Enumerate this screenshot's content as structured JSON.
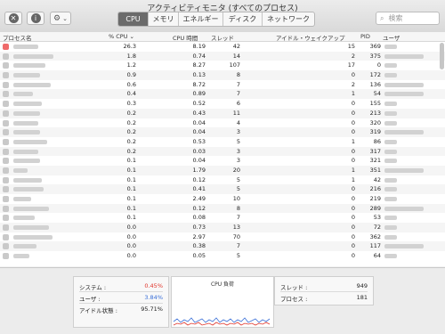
{
  "window": {
    "title": "アクティビティモニタ (すべてのプロセス)"
  },
  "toolbar": {
    "tabs": [
      "CPU",
      "メモリ",
      "エネルギー",
      "ディスク",
      "ネットワーク"
    ],
    "active_tab": "CPU",
    "search_placeholder": "検索",
    "icons": [
      "close-process-icon",
      "info-icon",
      "gear-icon"
    ],
    "gear_chevron": "⌄"
  },
  "table": {
    "headers": [
      "プロセス名",
      "% CPU",
      "CPU 時間",
      "スレッド",
      "アイドル・ウェイクアップ",
      "PID",
      "ユーザ"
    ],
    "rows": [
      {
        "cpu": "26.3",
        "time": "8.19",
        "threads": "42",
        "wake": "15",
        "pid": "369"
      },
      {
        "cpu": "1.8",
        "time": "0.74",
        "threads": "14",
        "wake": "2",
        "pid": "375"
      },
      {
        "cpu": "1.2",
        "time": "8.27",
        "threads": "107",
        "wake": "17",
        "pid": "0"
      },
      {
        "cpu": "0.9",
        "time": "0.13",
        "threads": "8",
        "wake": "0",
        "pid": "172"
      },
      {
        "cpu": "0.6",
        "time": "8.72",
        "threads": "7",
        "wake": "2",
        "pid": "136"
      },
      {
        "cpu": "0.4",
        "time": "0.89",
        "threads": "7",
        "wake": "1",
        "pid": "54"
      },
      {
        "cpu": "0.3",
        "time": "0.52",
        "threads": "6",
        "wake": "0",
        "pid": "155"
      },
      {
        "cpu": "0.2",
        "time": "0.43",
        "threads": "11",
        "wake": "0",
        "pid": "213"
      },
      {
        "cpu": "0.2",
        "time": "0.04",
        "threads": "4",
        "wake": "0",
        "pid": "320"
      },
      {
        "cpu": "0.2",
        "time": "0.04",
        "threads": "3",
        "wake": "0",
        "pid": "319"
      },
      {
        "cpu": "0.2",
        "time": "0.53",
        "threads": "5",
        "wake": "1",
        "pid": "86"
      },
      {
        "cpu": "0.2",
        "time": "0.03",
        "threads": "3",
        "wake": "0",
        "pid": "317"
      },
      {
        "cpu": "0.1",
        "time": "0.04",
        "threads": "3",
        "wake": "0",
        "pid": "321"
      },
      {
        "cpu": "0.1",
        "time": "1.79",
        "threads": "20",
        "wake": "1",
        "pid": "351"
      },
      {
        "cpu": "0.1",
        "time": "0.12",
        "threads": "5",
        "wake": "1",
        "pid": "42"
      },
      {
        "cpu": "0.1",
        "time": "0.41",
        "threads": "5",
        "wake": "0",
        "pid": "216"
      },
      {
        "cpu": "0.1",
        "time": "2.49",
        "threads": "10",
        "wake": "0",
        "pid": "219"
      },
      {
        "cpu": "0.1",
        "time": "0.12",
        "threads": "8",
        "wake": "0",
        "pid": "289"
      },
      {
        "cpu": "0.1",
        "time": "0.08",
        "threads": "7",
        "wake": "0",
        "pid": "53"
      },
      {
        "cpu": "0.0",
        "time": "0.73",
        "threads": "13",
        "wake": "0",
        "pid": "72"
      },
      {
        "cpu": "0.0",
        "time": "2.97",
        "threads": "70",
        "wake": "0",
        "pid": "362"
      },
      {
        "cpu": "0.0",
        "time": "0.38",
        "threads": "7",
        "wake": "0",
        "pid": "117"
      },
      {
        "cpu": "0.0",
        "time": "0.05",
        "threads": "5",
        "wake": "0",
        "pid": "64"
      }
    ]
  },
  "footer": {
    "system_label": "システム :",
    "system_value": "0.45%",
    "user_label": "ユーザ :",
    "user_value": "3.84%",
    "idle_label": "アイドル状態 :",
    "idle_value": "95.71%",
    "graph_title": "CPU 負荷",
    "threads_label": "スレッド :",
    "threads_value": "949",
    "processes_label": "プロセス :",
    "processes_value": "181"
  },
  "colors": {
    "system": "#e0362c",
    "user": "#3a6fd8",
    "active_tab": "#6b6b6b"
  }
}
